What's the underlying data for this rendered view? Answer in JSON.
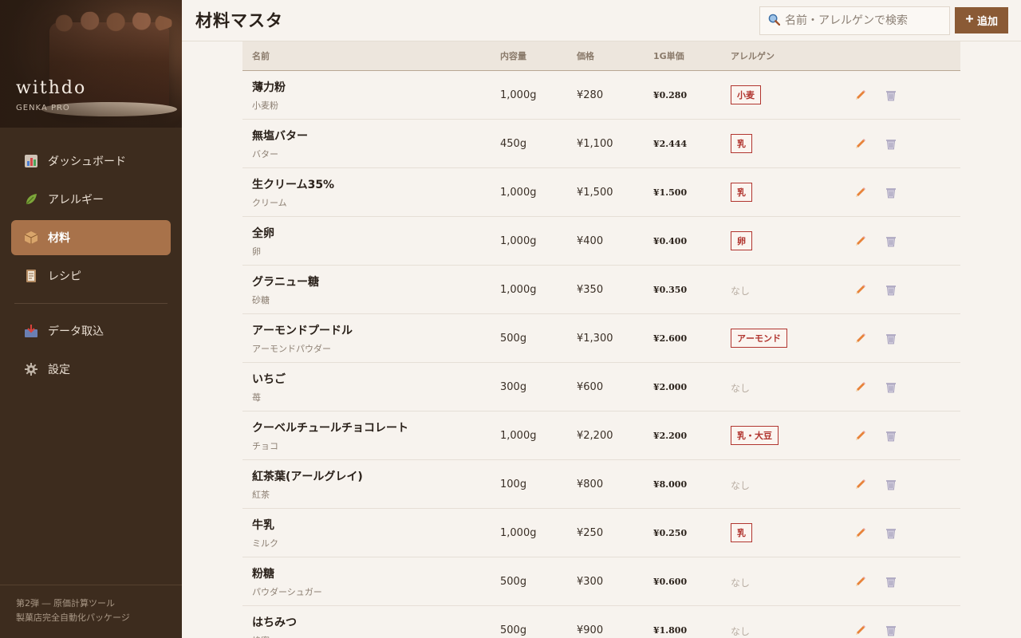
{
  "brand": {
    "name": "withdo",
    "subtitle": "GENKA PRO"
  },
  "sidebar": {
    "items": [
      {
        "label": "ダッシュボード",
        "icon": "chart-icon"
      },
      {
        "label": "アレルギー",
        "icon": "leaf-icon"
      },
      {
        "label": "材料",
        "icon": "box-icon",
        "active": true
      },
      {
        "label": "レシピ",
        "icon": "notebook-icon"
      },
      {
        "label": "データ取込",
        "icon": "inbox-icon"
      },
      {
        "label": "設定",
        "icon": "gear-icon"
      }
    ],
    "footer_line1": "第2弾 ― 原価計算ツール",
    "footer_line2": "製菓店完全自動化パッケージ"
  },
  "header": {
    "title": "材料マスタ",
    "search_placeholder": "名前・アレルゲンで検索",
    "add_label": "追加"
  },
  "table": {
    "columns": {
      "name": "名前",
      "qty": "内容量",
      "price": "価格",
      "unit": "1G単価",
      "allergy": "アレルゲン"
    },
    "rows": [
      {
        "name": "薄力粉",
        "sub": "小麦粉",
        "qty": "1,000g",
        "price": "¥280",
        "unit": "¥0.280",
        "allergy": "小麦"
      },
      {
        "name": "無塩バター",
        "sub": "バター",
        "qty": "450g",
        "price": "¥1,100",
        "unit": "¥2.444",
        "allergy": "乳"
      },
      {
        "name": "生クリーム35%",
        "sub": "クリーム",
        "qty": "1,000g",
        "price": "¥1,500",
        "unit": "¥1.500",
        "allergy": "乳"
      },
      {
        "name": "全卵",
        "sub": "卵",
        "qty": "1,000g",
        "price": "¥400",
        "unit": "¥0.400",
        "allergy": "卵"
      },
      {
        "name": "グラニュー糖",
        "sub": "砂糖",
        "qty": "1,000g",
        "price": "¥350",
        "unit": "¥0.350",
        "allergy": ""
      },
      {
        "name": "アーモンドプードル",
        "sub": "アーモンドパウダー",
        "qty": "500g",
        "price": "¥1,300",
        "unit": "¥2.600",
        "allergy": "アーモンド"
      },
      {
        "name": "いちご",
        "sub": "苺",
        "qty": "300g",
        "price": "¥600",
        "unit": "¥2.000",
        "allergy": ""
      },
      {
        "name": "クーベルチュールチョコレート",
        "sub": "チョコ",
        "qty": "1,000g",
        "price": "¥2,200",
        "unit": "¥2.200",
        "allergy": "乳・大豆"
      },
      {
        "name": "紅茶葉(アールグレイ)",
        "sub": "紅茶",
        "qty": "100g",
        "price": "¥800",
        "unit": "¥8.000",
        "allergy": ""
      },
      {
        "name": "牛乳",
        "sub": "ミルク",
        "qty": "1,000g",
        "price": "¥250",
        "unit": "¥0.250",
        "allergy": "乳"
      },
      {
        "name": "粉糖",
        "sub": "パウダーシュガー",
        "qty": "500g",
        "price": "¥300",
        "unit": "¥0.600",
        "allergy": ""
      },
      {
        "name": "はちみつ",
        "sub": "蜂蜜",
        "qty": "500g",
        "price": "¥900",
        "unit": "¥1.800",
        "allergy": ""
      }
    ],
    "none_label": "なし"
  }
}
